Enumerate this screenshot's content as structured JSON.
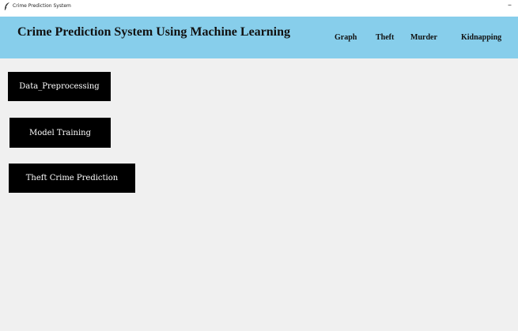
{
  "window": {
    "title": "Crime Prediction System",
    "minimize_glyph": "–",
    "app_icon": "feather-icon"
  },
  "header": {
    "title": "Crime Prediction System Using Machine Learning",
    "background_color": "#87ceeb",
    "nav": [
      "Graph",
      "Theft",
      "Murder",
      "Kidnapping"
    ]
  },
  "actions": {
    "data_preprocessing": "Data_Preprocessing",
    "model_training": "Model Training",
    "theft_prediction": "Theft Crime Prediction"
  },
  "colors": {
    "button_bg": "#000000",
    "button_text": "#ffffff",
    "page_bg": "#f0f0f0"
  }
}
